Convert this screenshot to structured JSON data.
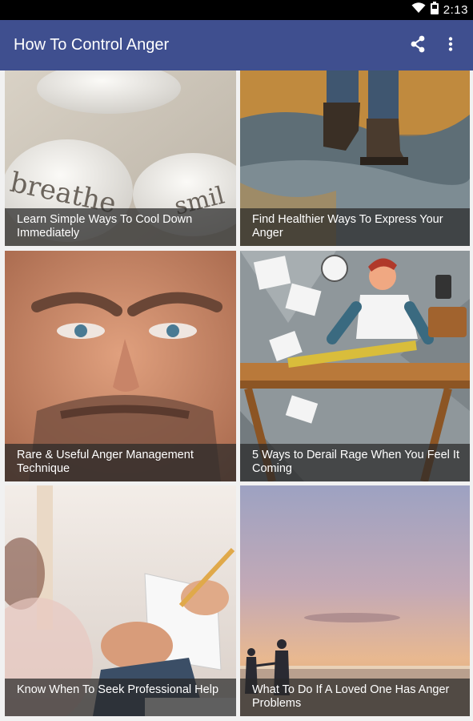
{
  "status_bar": {
    "time": "2:13",
    "icons": [
      "wifi-icon",
      "battery-icon"
    ]
  },
  "app_bar": {
    "title": "How To Control Anger",
    "background": "#3f4f8f",
    "actions": [
      "share-icon",
      "more-vert-icon"
    ]
  },
  "cards": [
    {
      "title": "Learn Simple Ways To Cool Down Immediately",
      "image": "breathe-smile-stones",
      "image_text": [
        "breathe",
        "smil"
      ]
    },
    {
      "title": "Find Healthier Ways To Express Your Anger",
      "image": "boots-walking-in-water"
    },
    {
      "title": "Rare & Useful Anger Management Technique",
      "image": "angry-man-face"
    },
    {
      "title": "5 Ways to Derail Rage When You Feel It Coming",
      "image": "angry-man-smashing-desk-illustration"
    },
    {
      "title": "Know When To Seek Professional Help",
      "image": "therapist-taking-notes"
    },
    {
      "title": "What To Do If A Loved One Has Anger Problems",
      "image": "couple-walking-at-sunset-beach"
    }
  ]
}
